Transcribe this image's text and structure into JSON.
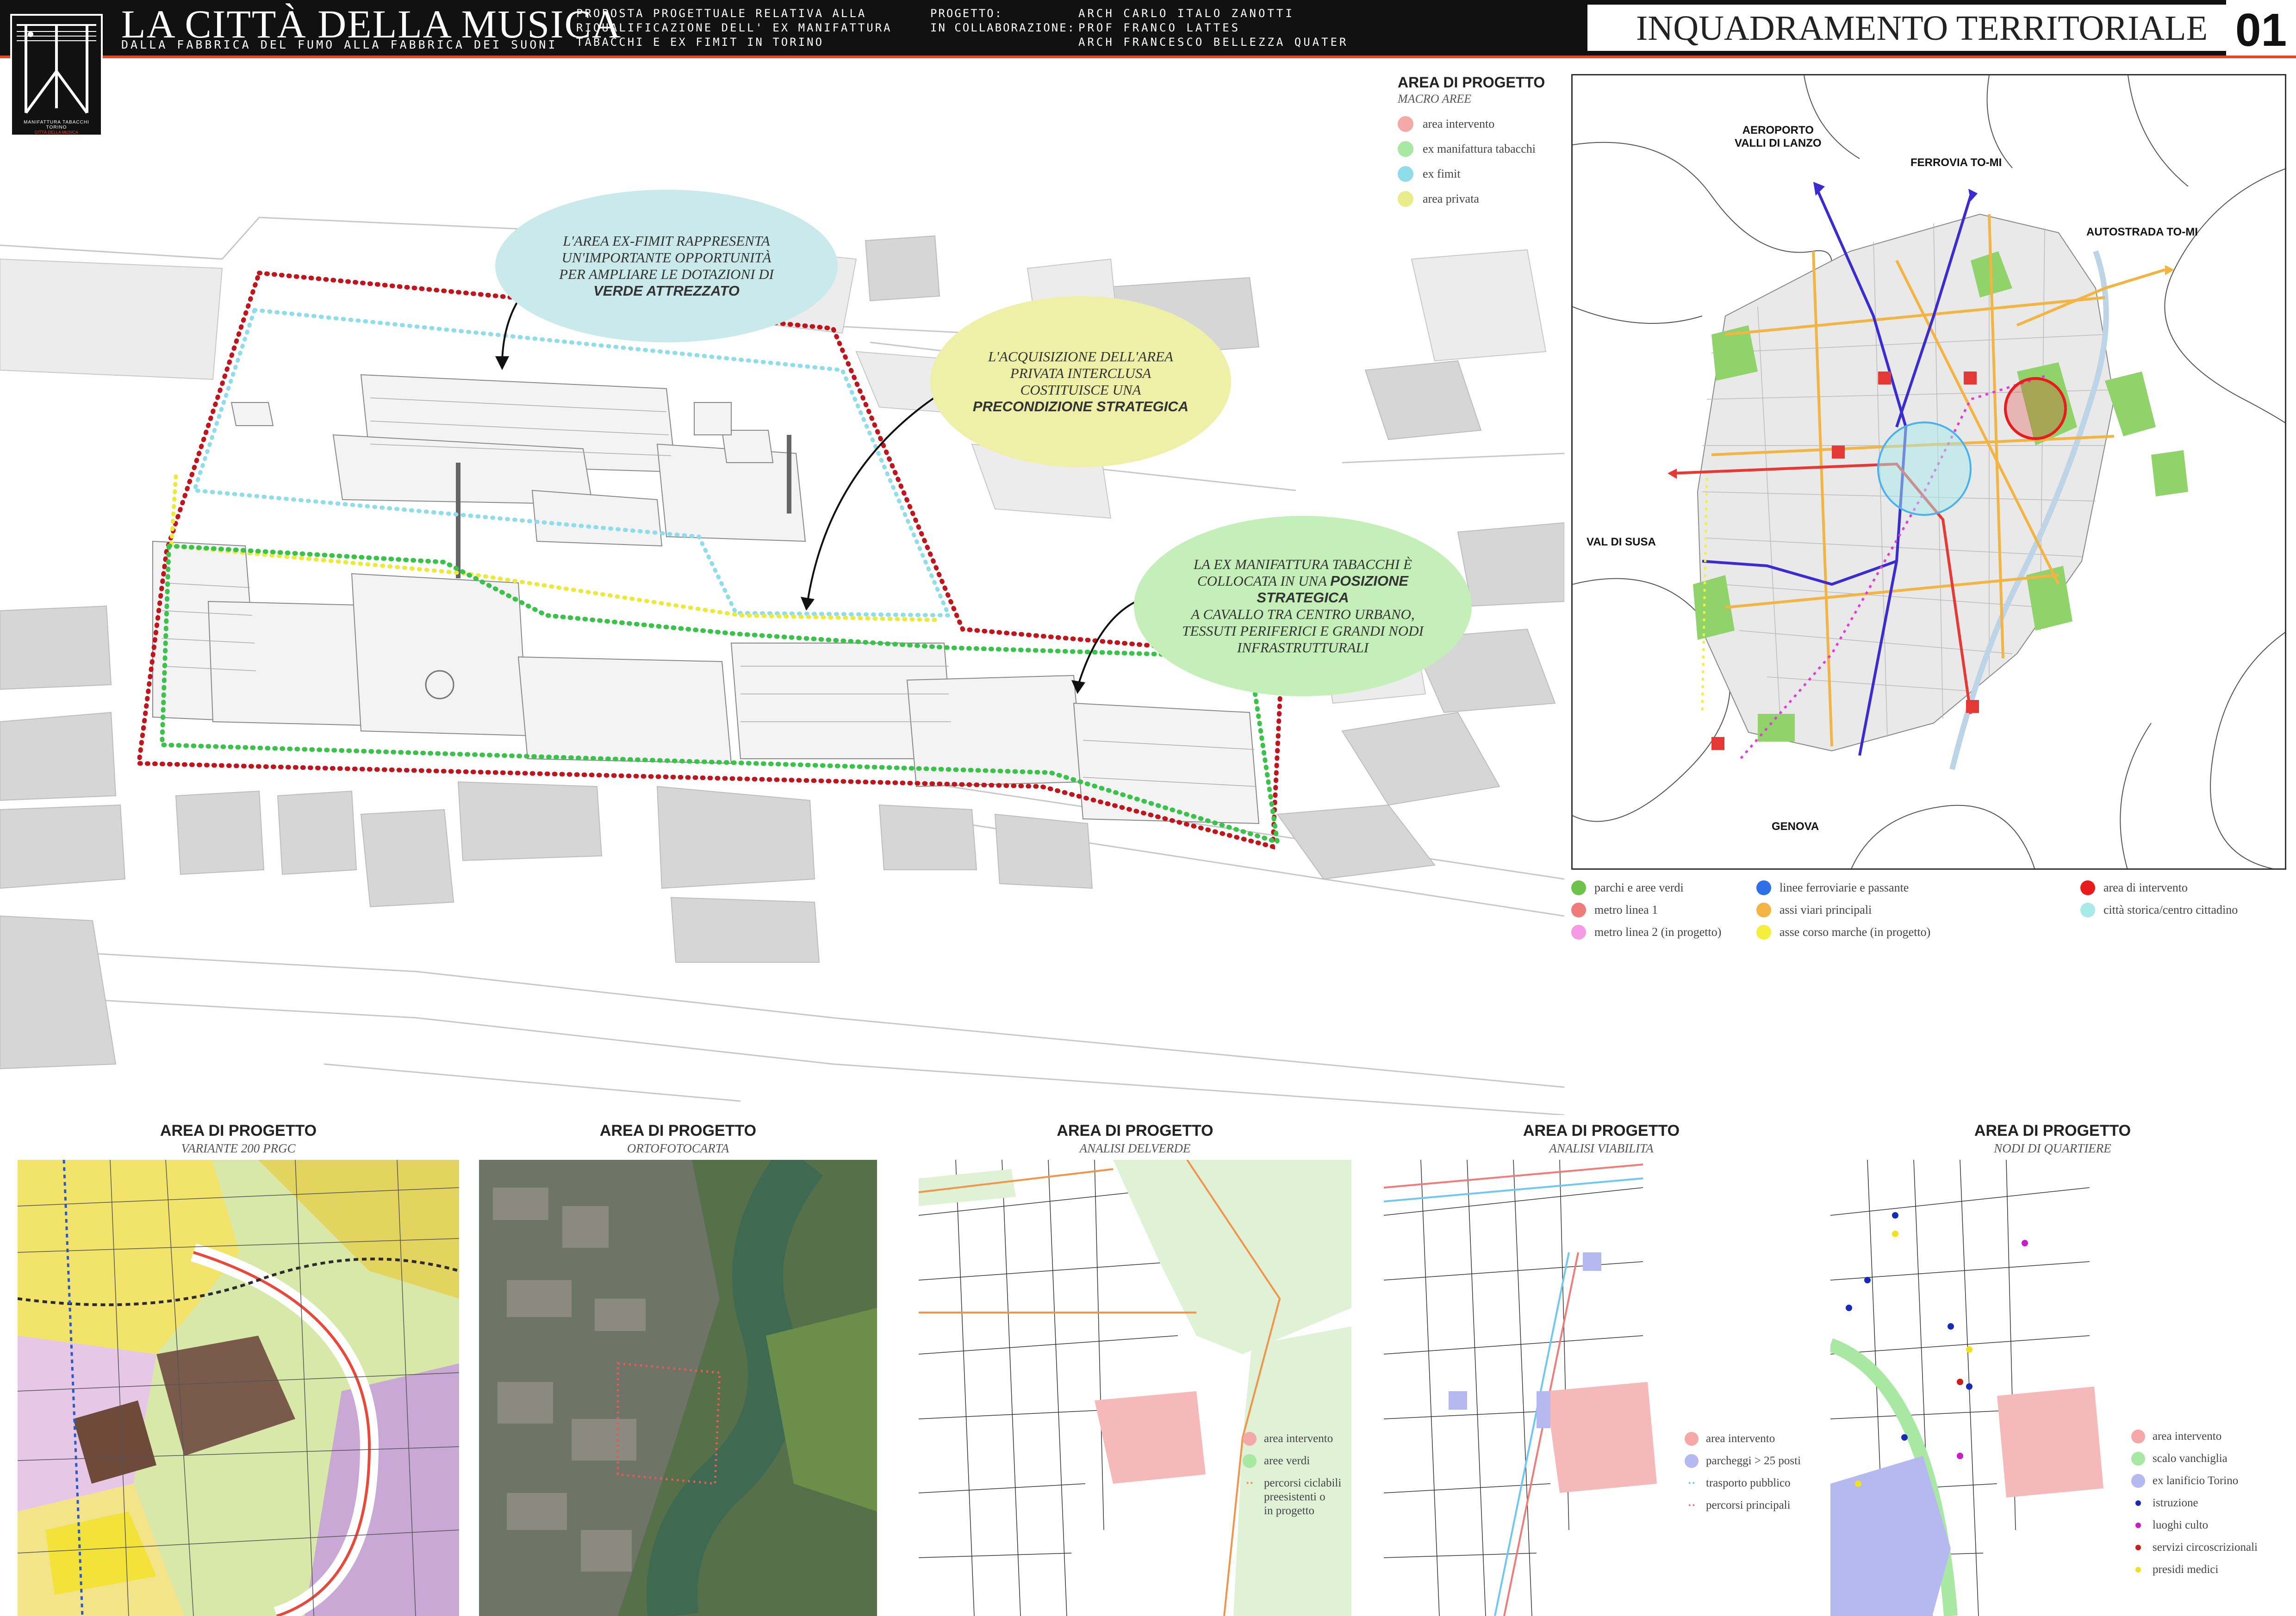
{
  "header": {
    "title": "LA CITTÀ DELLA MUSICA",
    "subtitle": "DALLA FABBRICA DEL FUMO ALLA FABBRICA DEI SUONI",
    "proposal_lines": [
      "PROPOSTA PROGETTUALE RELATIVA ALLA",
      "RIQUALIFICAZIONE DELL' EX MANIFATTURA",
      "TABACCHI E EX FIMIT IN TORINO"
    ],
    "project_label": "PROGETTO:",
    "collab_label": "IN COLLABORAZIONE:",
    "authors": [
      "ARCH CARLO ITALO ZANOTTI",
      "PROF FRANCO LATTES",
      "ARCH FRANCESCO BELLEZZA QUATER"
    ],
    "section_title": "INQUADRAMENTO TERRITORIALE",
    "sheet_number": "01",
    "logo_caption": "MANIFATTURA TABACCHI TORINO",
    "logo_caption2": "CITTÀ DELLA MUSICA",
    "accent_color": "#e04a2a"
  },
  "bubbles": [
    {
      "lines_before": [
        "L'AREA EX-FIMIT RAPPRESENTA",
        "UN'IMPORTANTE OPPORTUNITÀ",
        "PER AMPLIARE LE DOTAZIONI DI"
      ],
      "bold": "VERDE ATTREZZATO",
      "color": "#c9e9ea"
    },
    {
      "lines_before": [
        "L'ACQUISIZIONE DELL'AREA",
        "PRIVATA INTERCLUSA",
        "COSTITUISCE UNA"
      ],
      "bold": "PRECONDIZIONE STRATEGICA",
      "color": "#eef0a7"
    },
    {
      "text_a": "LA EX MANIFATTURA TABACCHI È",
      "text_b": "COLLOCATA IN UNA",
      "bold": "POSIZIONE STRATEGICA",
      "text_c": "A CAVALLO TRA CENTRO URBANO,",
      "text_d": "TESSUTI PERIFERICI E GRANDI NODI",
      "text_e": "INFRASTRUTTURALI",
      "color": "#c4efb8"
    }
  ],
  "macro_legend": {
    "title": "AREA DI PROGETTO",
    "subtitle": "MACRO AREE",
    "items": [
      {
        "label": "area intervento",
        "color": "#f4a8a8"
      },
      {
        "label": "ex manifattura tabacchi",
        "color": "#a9e8a3"
      },
      {
        "label": "ex fimit",
        "color": "#8fdde8"
      },
      {
        "label": "area privata",
        "color": "#e8ec8a"
      }
    ]
  },
  "territorial_map": {
    "labels": {
      "airport": "AEROPORTO\nVALLI DI LANZO",
      "railway": "FERROVIA TO-MI",
      "highway": "AUTOSTRADA TO-MI",
      "susa": "VAL DI SUSA",
      "genova": "GENOVA"
    }
  },
  "territorial_legend": {
    "col1": [
      {
        "label": "parchi e aree verdi",
        "color": "#6cc24a"
      },
      {
        "label": "metro linea 1",
        "color": "#f07b7b"
      },
      {
        "label": "metro linea 2 (in progetto)",
        "color": "#f59be6"
      }
    ],
    "col2": [
      {
        "label": "linee ferroviarie e passante",
        "color": "#2f6fe8"
      },
      {
        "label": "assi viari principali",
        "color": "#f2b544"
      },
      {
        "label": "asse corso marche (in progetto)",
        "color": "#f4ef3c"
      }
    ],
    "col3": [
      {
        "label": "area di intervento",
        "color": "#e81c1c"
      },
      {
        "label": "città storica/centro cittadino",
        "color": "#a8eaea"
      }
    ]
  },
  "panels": [
    {
      "title": "AREA DI PROGETTO",
      "subtitle": "VARIANTE 200 PRGC"
    },
    {
      "title": "AREA DI PROGETTO",
      "subtitle": "ORTOFOTOCARTA"
    },
    {
      "title": "AREA DI PROGETTO",
      "subtitle": "ANALISI DELVERDE",
      "legend": [
        {
          "label": "area intervento",
          "color": "#f4a8a8",
          "kind": "dot"
        },
        {
          "label": "aree verdi",
          "color": "#a9e8a3",
          "kind": "dot"
        },
        {
          "label": "percorsi ciclabili\npreesistenti o\nin progetto",
          "color": "#f2944a",
          "kind": "dots"
        }
      ]
    },
    {
      "title": "AREA DI PROGETTO",
      "subtitle": "ANALISI VIABILITA",
      "legend": [
        {
          "label": "area intervento",
          "color": "#f4a8a8",
          "kind": "dot"
        },
        {
          "label": "parcheggi > 25 posti",
          "color": "#b6b8f0",
          "kind": "dot"
        },
        {
          "label": "trasporto pubblico",
          "color": "#6fc8ee",
          "kind": "dots"
        },
        {
          "label": "percorsi principali",
          "color": "#f07b7b",
          "kind": "dots"
        }
      ]
    },
    {
      "title": "AREA DI PROGETTO",
      "subtitle": "NODI DI QUARTIERE",
      "legend": [
        {
          "label": "area intervento",
          "color": "#f4a8a8",
          "kind": "dot"
        },
        {
          "label": "scalo vanchiglia",
          "color": "#a9e8a3",
          "kind": "dot"
        },
        {
          "label": "ex lanificio Torino",
          "color": "#b6b8f0",
          "kind": "dot"
        },
        {
          "label": "istruzione",
          "color": "#1a2ab8",
          "kind": "small"
        },
        {
          "label": "luoghi culto",
          "color": "#c81ec8",
          "kind": "small"
        },
        {
          "label": "servizi circoscrizionali",
          "color": "#c81e1e",
          "kind": "small"
        },
        {
          "label": "presidi medici",
          "color": "#f2e21e",
          "kind": "small"
        }
      ]
    }
  ]
}
